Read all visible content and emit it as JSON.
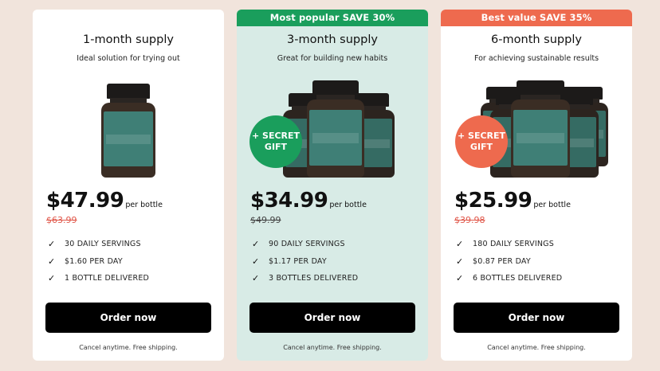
{
  "plans": [
    {
      "badge": "",
      "title": "1-month supply",
      "subtitle": "Ideal solution for trying out",
      "price": "$47.99",
      "per": "per bottle",
      "old_price": "$63.99",
      "features": [
        "30 DAILY SERVINGS",
        "$1.60 PER DAY",
        "1 BOTTLE DELIVERED"
      ],
      "cta": "Order now",
      "fine_print": "Cancel anytime. Free shipping."
    },
    {
      "badge": "Most popular SAVE 30%",
      "title": "3-month supply",
      "subtitle": "Great for building new habits",
      "gift_line1": "+ SECRET",
      "gift_line2": "GIFT",
      "price": "$34.99",
      "per": "per bottle",
      "old_price": "$49.99",
      "features": [
        "90 DAILY SERVINGS",
        "$1.17 PER DAY",
        "3 BOTTLES DELIVERED"
      ],
      "cta": "Order now",
      "fine_print": "Cancel anytime. Free shipping."
    },
    {
      "badge": "Best value SAVE 35%",
      "title": "6-month supply",
      "subtitle": "For achieving sustainable results",
      "gift_line1": "+ SECRET",
      "gift_line2": "GIFT",
      "price": "$25.99",
      "per": "per bottle",
      "old_price": "$39.98",
      "features": [
        "180 DAILY SERVINGS",
        "$0.87 PER DAY",
        "6 BOTTLES DELIVERED"
      ],
      "cta": "Order now",
      "fine_print": "Cancel anytime. Free shipping."
    }
  ],
  "check_glyph": "✓",
  "icons": {
    "feature": "check-icon",
    "product": "probiotics-bottle-image",
    "gift": "secret-gift-badge"
  },
  "colors": {
    "page_bg": "#f1e4dc",
    "popular": "#1a9e5c",
    "best_value": "#ee6a4e",
    "popular_card_bg": "#d8ebe6",
    "cta_bg": "#000000",
    "old_price_red": "#e0574a"
  }
}
